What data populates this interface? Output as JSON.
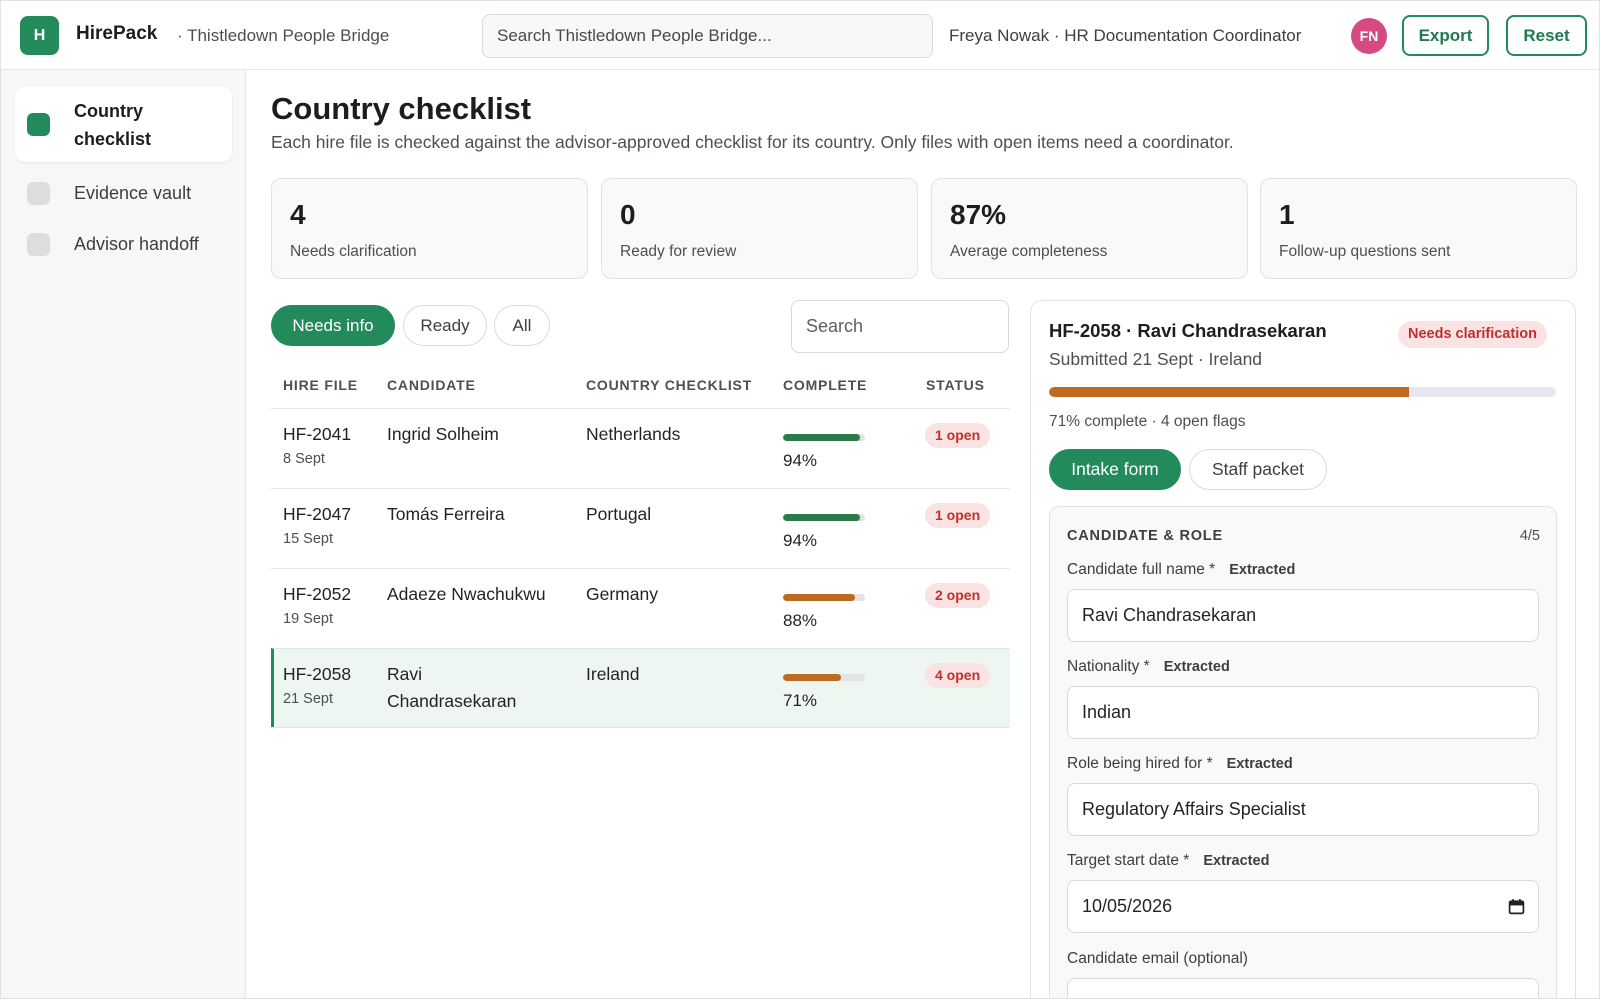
{
  "header": {
    "logo_letter": "H",
    "brand": "HirePack",
    "org": "· Thistledown People Bridge",
    "search_placeholder": "Search Thistledown People Bridge...",
    "user": "Freya Nowak · HR Documentation Coordinator",
    "avatar_initials": "FN",
    "export_label": "Export",
    "reset_label": "Reset"
  },
  "sidebar": {
    "items": [
      {
        "label": "Country checklist",
        "active": true
      },
      {
        "label": "Evidence vault",
        "active": false
      },
      {
        "label": "Advisor handoff",
        "active": false
      }
    ]
  },
  "main": {
    "title": "Country checklist",
    "subtitle": "Each hire file is checked against the advisor-approved checklist for its country. Only files with open items need a coordinator.",
    "stats": [
      {
        "value": "4",
        "caption": "Needs clarification"
      },
      {
        "value": "0",
        "caption": "Ready for review"
      },
      {
        "value": "87%",
        "caption": "Average completeness"
      },
      {
        "value": "1",
        "caption": "Follow-up questions sent"
      }
    ],
    "filters": [
      "Needs info",
      "Ready",
      "All"
    ],
    "search_placeholder": "Search",
    "columns": [
      "HIRE FILE",
      "CANDIDATE",
      "COUNTRY CHECKLIST",
      "COMPLETE",
      "STATUS"
    ],
    "rows": [
      {
        "id": "HF-2041",
        "date": "8 Sept",
        "candidate": "Ingrid Solheim",
        "country": "Netherlands",
        "complete": 94,
        "complete_label": "94%",
        "status": "1 open",
        "bar_color": "#2a7a4e"
      },
      {
        "id": "HF-2047",
        "date": "15 Sept",
        "candidate": "Tomás Ferreira",
        "country": "Portugal",
        "complete": 94,
        "complete_label": "94%",
        "status": "1 open",
        "bar_color": "#2a7a4e"
      },
      {
        "id": "HF-2052",
        "date": "19 Sept",
        "candidate": "Adaeze Nwachukwu",
        "country": "Germany",
        "complete": 88,
        "complete_label": "88%",
        "status": "2 open",
        "bar_color": "#bd6a22"
      },
      {
        "id": "HF-2058",
        "date": "21 Sept",
        "candidate": "Ravi Chandrasekaran",
        "country": "Ireland",
        "complete": 71,
        "complete_label": "71%",
        "status": "4 open",
        "bar_color": "#bd6a22"
      }
    ]
  },
  "detail": {
    "title": "HF-2058 · Ravi Chandrasekaran",
    "badge": "Needs clarification",
    "submitted": "Submitted 21 Sept · Ireland",
    "progress": 71,
    "meta": "71% complete · 4 open flags",
    "tabs": [
      "Intake form",
      "Staff packet"
    ],
    "section_title": "CANDIDATE & ROLE",
    "section_count": "4/5",
    "fields": [
      {
        "label": "Candidate full name *",
        "tag": "Extracted",
        "value": "Ravi Chandrasekaran"
      },
      {
        "label": "Nationality *",
        "tag": "Extracted",
        "value": "Indian"
      },
      {
        "label": "Role being hired for *",
        "tag": "Extracted",
        "value": "Regulatory Affairs Specialist"
      },
      {
        "label": "Target start date *",
        "tag": "Extracted",
        "value": "10/05/2026"
      },
      {
        "label": "Candidate email (optional)",
        "tag": "",
        "value": ""
      }
    ]
  }
}
